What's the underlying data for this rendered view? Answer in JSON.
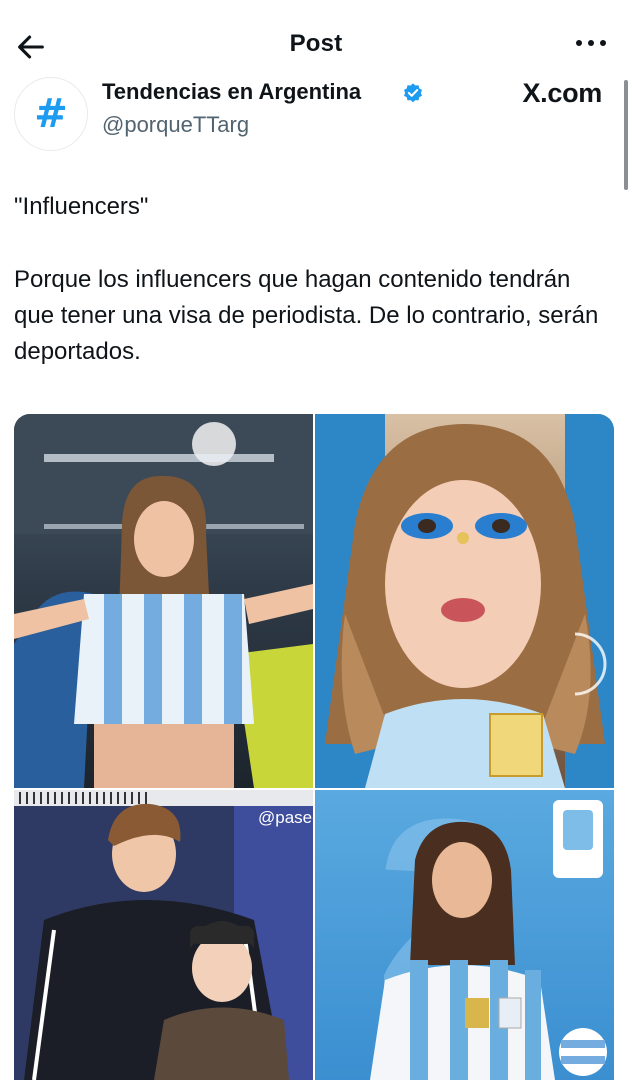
{
  "header": {
    "title": "Post",
    "back_icon": "arrow-left-icon",
    "more_icon": "more-horizontal-icon"
  },
  "post": {
    "author_name": "Tendencias en Argentina",
    "author_handle": "@porqueTTarg",
    "avatar_glyph": "#",
    "verified_icon": "verified-badge-icon",
    "source": "X.com",
    "text_line1": "\"Influencers\"",
    "text_body": "Porque los influencers que hagan contenido tendrán que tener una visa de periodista. De lo contrario, serán deportados."
  },
  "media": {
    "watermark": "@paseclave_",
    "photos": [
      "stadium-fan-photo",
      "makeup-portrait-photo",
      "couple-studio-photo",
      "jersey-portrait-photo"
    ]
  },
  "colors": {
    "accent": "#1d9bf0",
    "text": "#0f1419",
    "muted": "#536471"
  }
}
